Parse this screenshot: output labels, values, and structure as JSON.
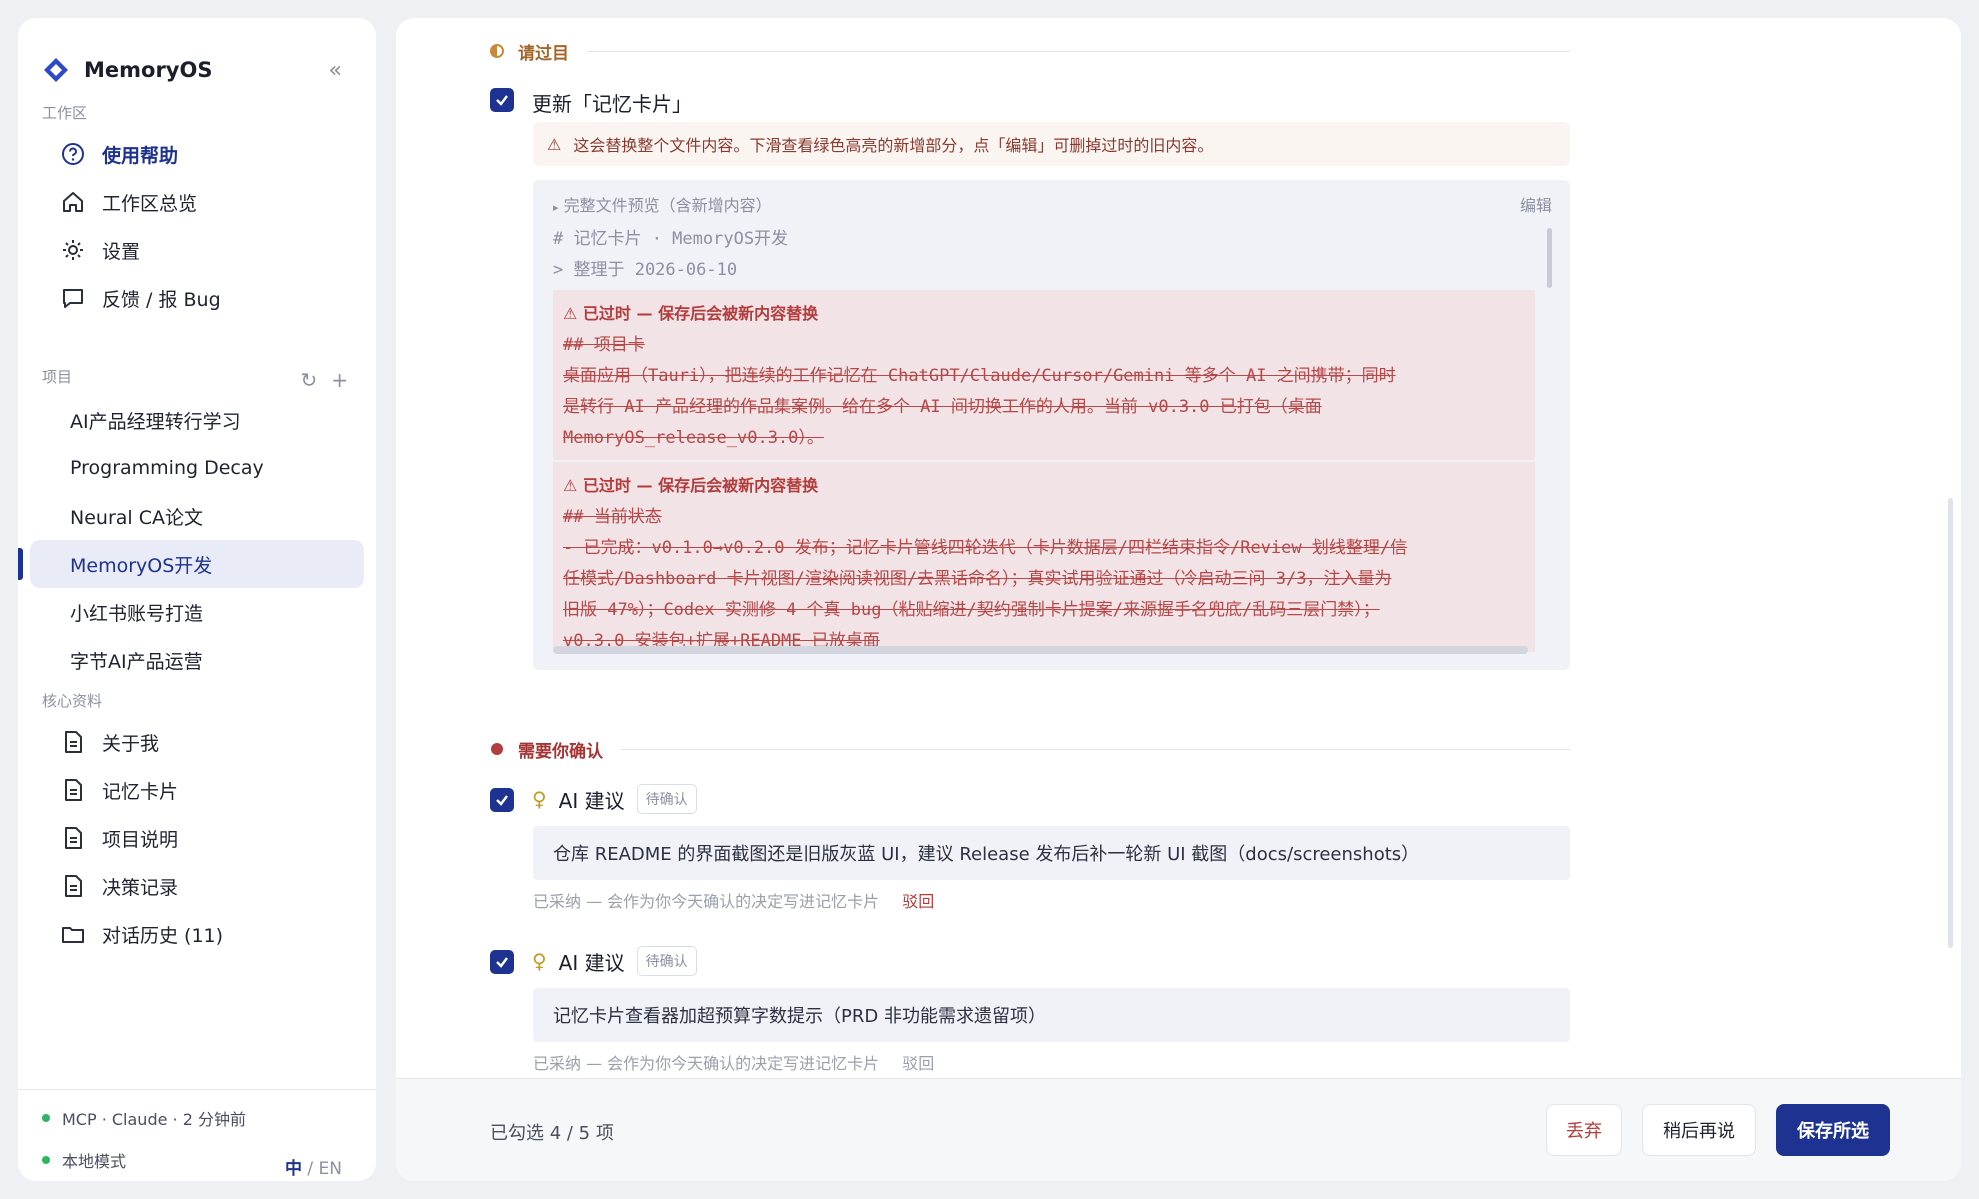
{
  "app": {
    "name": "MemoryOS"
  },
  "sidebar": {
    "workspace_label": "工作区",
    "nav": [
      {
        "label": "使用帮助",
        "icon": "help-circle-icon",
        "active": true
      },
      {
        "label": "工作区总览",
        "icon": "home-icon"
      },
      {
        "label": "设置",
        "icon": "gear-icon"
      },
      {
        "label": "反馈 / 报 Bug",
        "icon": "chat-bubble-icon"
      }
    ],
    "projects_label": "项目",
    "projects": [
      {
        "label": "AI产品经理转行学习"
      },
      {
        "label": "Programming Decay"
      },
      {
        "label": "Neural CA论文"
      },
      {
        "label": "MemoryOS开发",
        "active": true
      },
      {
        "label": "小红书账号打造"
      },
      {
        "label": "字节AI产品运营"
      }
    ],
    "core_label": "核心资料",
    "core": [
      {
        "label": "关于我",
        "icon": "document-icon"
      },
      {
        "label": "记忆卡片",
        "icon": "document-icon"
      },
      {
        "label": "项目说明",
        "icon": "document-icon"
      },
      {
        "label": "决策记录",
        "icon": "document-icon"
      },
      {
        "label": "对话历史 (11)",
        "icon": "folder-icon"
      }
    ],
    "footer": {
      "mcp_status": "MCP · Claude · 2 分钟前",
      "mode": "本地模式",
      "lang_zh": "中",
      "lang_sep": "/",
      "lang_en": "EN"
    }
  },
  "main": {
    "review_group": {
      "title": "请过目",
      "item_title": "更新「记忆卡片」",
      "warning": "这会替换整个文件内容。下滑查看绿色高亮的新增部分，点「编辑」可删掉过时的旧内容。",
      "preview": {
        "summary": "完整文件预览（含新增内容）",
        "edit_label": "编辑",
        "line1": "# 记忆卡片 · MemoryOS开发",
        "line2": "> 整理于 2026-06-10",
        "outdated_blocks": [
          {
            "head": "已过时 — 保存后会被新内容替换",
            "lines": [
              "## 项目卡",
              "桌面应用（Tauri），把连续的工作记忆在 ChatGPT/Claude/Cursor/Gemini 等多个 AI 之间携带；同时",
              "是转行 AI 产品经理的作品集案例。给在多个 AI 间切换工作的人用。当前 v0.3.0 已打包（桌面",
              "MemoryOS_release_v0.3.0）。"
            ]
          },
          {
            "head": "已过时 — 保存后会被新内容替换",
            "lines": [
              "## 当前状态",
              "- 已完成：v0.1.0→v0.2.0 发布；记忆卡片管线四轮迭代（卡片数据层/四栏结束指令/Review 划线整理/信",
              "任模式/Dashboard 卡片视图/渲染阅读视图/去黑话命名）；真实试用验证通过（冷启动三问 3/3，注入量为",
              "旧版 47%）；Codex 实测修 4 个真 bug（粘贴缩进/契约强制卡片提案/来源握手名兜底/乱码三层门禁）；",
              "v0.3.0 安装包+扩展+README 已放桌面"
            ]
          }
        ]
      }
    },
    "confirm_group": {
      "title": "需要你确认",
      "items": [
        {
          "label": "AI 建议",
          "badge": "待确认",
          "text": "仓库 README 的界面截图还是旧版灰蓝 UI，建议 Release 发布后补一轮新 UI 截图（docs/screenshots）",
          "meta": "已采纳 — 会作为你今天确认的决定写进记忆卡片",
          "reject": "驳回"
        },
        {
          "label": "AI 建议",
          "badge": "待确认",
          "text": "记忆卡片查看器加超预算字数提示（PRD 非功能需求遗留项）",
          "meta": "已采纳 — 会作为你今天确认的决定写进记忆卡片",
          "reject": "驳回"
        }
      ]
    },
    "footer": {
      "count": "已勾选 4 / 5 项",
      "discard": "丢弃",
      "later": "稍后再说",
      "save": "保存所选"
    }
  },
  "colors": {
    "accent": "#1d3291",
    "danger": "#b33c3c",
    "review_marker": "#c98a3c",
    "status_green": "#2fb464"
  }
}
